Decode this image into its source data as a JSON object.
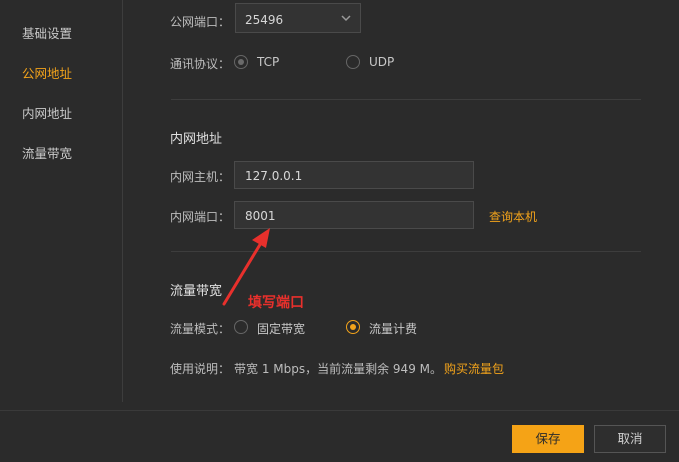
{
  "sidebar": {
    "items": [
      {
        "label": "基础设置",
        "active": false
      },
      {
        "label": "公网地址",
        "active": true
      },
      {
        "label": "内网地址",
        "active": false
      },
      {
        "label": "流量带宽",
        "active": false
      }
    ]
  },
  "public": {
    "port_label": "公网端口：",
    "port_value": "25496",
    "protocol_label": "通讯协议：",
    "protocol_options": [
      "TCP",
      "UDP"
    ],
    "protocol_selected": "TCP"
  },
  "intranet": {
    "title": "内网地址",
    "host_label": "内网主机：",
    "host_value": "127.0.0.1",
    "port_label": "内网端口：",
    "port_value": "8001",
    "query_link": "查询本机"
  },
  "bandwidth": {
    "title": "流量带宽",
    "mode_label": "流量模式：",
    "mode_options": [
      "固定带宽",
      "流量计费"
    ],
    "mode_selected": "流量计费",
    "usage_label": "使用说明：",
    "usage_text": "带宽 1 Mbps，当前流量剩余 949 M。",
    "buy_link": "购买流量包"
  },
  "annotation": {
    "text": "填写端口",
    "color": "#e8302c"
  },
  "footer": {
    "save_label": "保存",
    "cancel_label": "取消"
  },
  "colors": {
    "accent": "#f2a31b",
    "background": "#2b2b2b"
  }
}
